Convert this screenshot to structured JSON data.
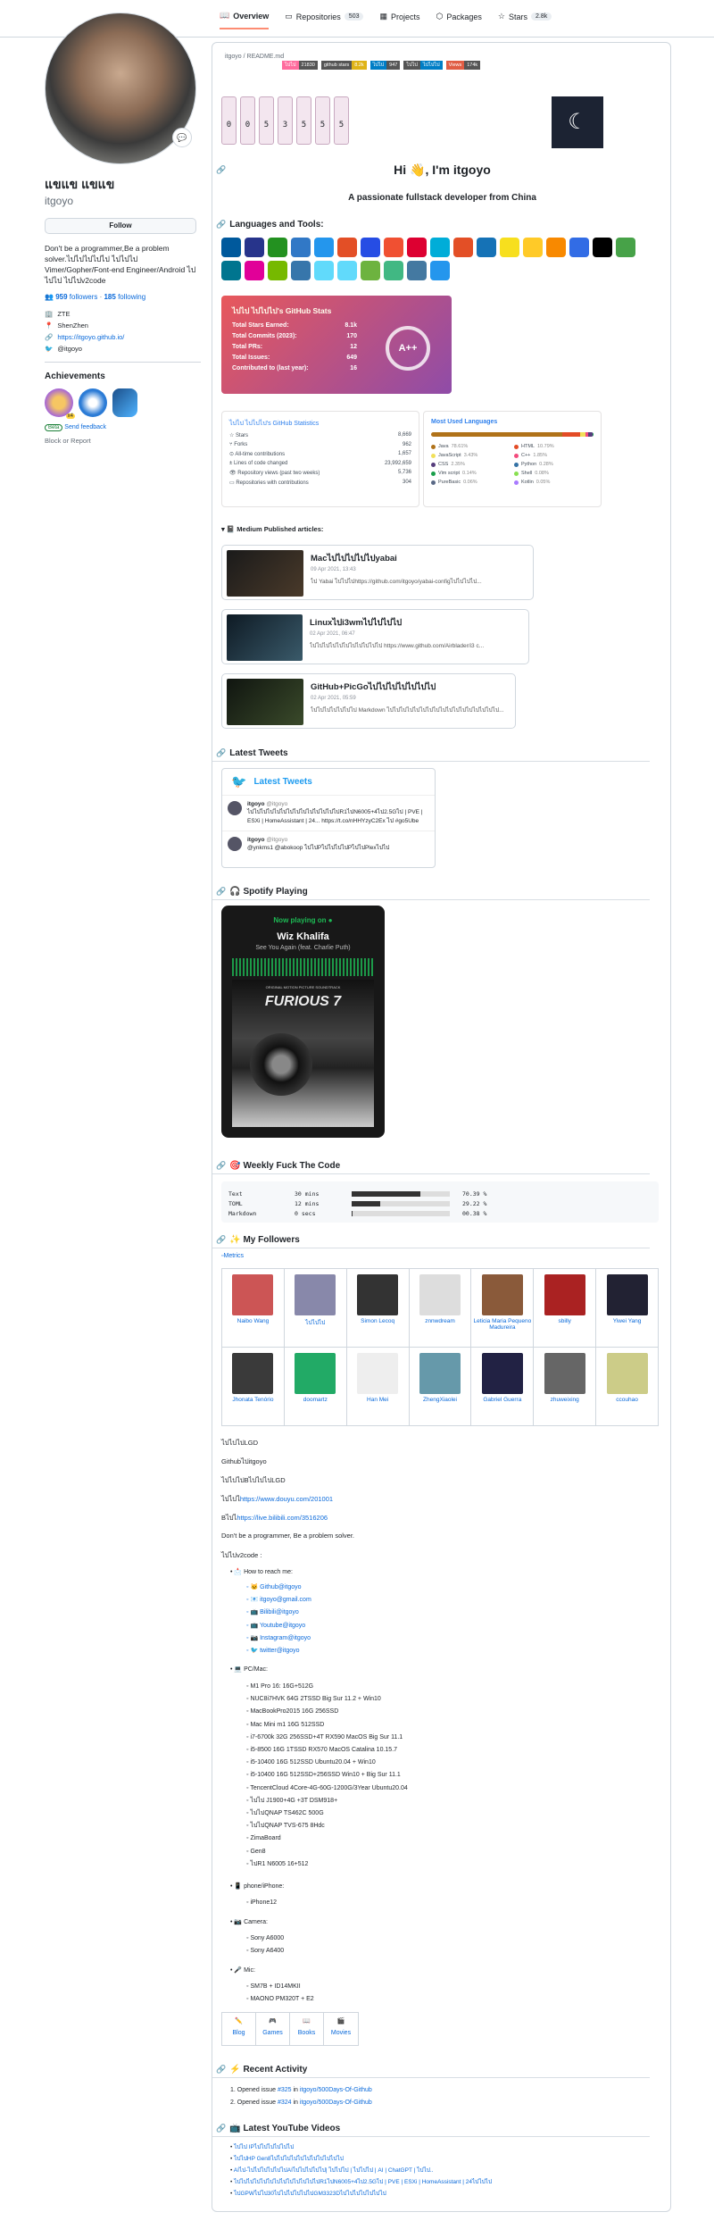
{
  "nav": {
    "tabs": [
      {
        "label": "Overview"
      },
      {
        "label": "Repositories",
        "count": "503"
      },
      {
        "label": "Projects"
      },
      {
        "label": "Packages"
      },
      {
        "label": "Stars",
        "count": "2.8k"
      }
    ]
  },
  "profile": {
    "name": "แขแข แขแข",
    "login": "itgoyo",
    "follow_label": "Follow",
    "bio": "Don't be a programmer,Be a problem solver.ไปไปไปไปไป ไปไปไป Vimer/Gopher/Font-end Engineer/Android ไปไปไป ไปไปv2code",
    "followers_count": "959",
    "followers_label": "followers",
    "following_count": "185",
    "following_label": "following",
    "company": "ZTE",
    "location": "ShenZhen",
    "website": "https://itgoyo.github.io/",
    "twitter": "@itgoyo",
    "achievements_title": "Achievements",
    "beta_label": "Beta",
    "feedback_label": "Send feedback",
    "block_label": "Block or Report",
    "badge_count": "x4"
  },
  "readme": {
    "path": "itgoyo / README.md",
    "badges": [
      {
        "left": "ไปไป",
        "right": "21830",
        "color": "#e05d44"
      },
      {
        "left": "github stars",
        "right": "8.2k",
        "color": "#dfb317"
      },
      {
        "left": "ไปไป",
        "right": "947",
        "color": "#007ec6"
      },
      {
        "left": "ไปไป",
        "right": "ไปไปไป",
        "color": "#007ec6"
      },
      {
        "left": "Views",
        "right": "174k",
        "color": "#e05d44"
      }
    ],
    "counter_digits": [
      "0",
      "0",
      "5",
      "3",
      "5",
      "5",
      "5"
    ],
    "moon_glyph": "☾",
    "greeting": "Hi 👋, I'm itgoyo",
    "tagline": "A passionate fullstack developer from China",
    "languages_heading": "Languages and Tools:",
    "logo_colors": [
      "#00599c",
      "#27348b",
      "#239120",
      "#3178c6",
      "#2496ed",
      "#e34f26",
      "#264de4",
      "#f05032",
      "#dd0031",
      "#00add8",
      "#e34f26",
      "#1572b6",
      "#f7df1e",
      "#ffca28",
      "#f88900",
      "#326ce5",
      "#000000",
      "#47a248",
      "#00758f",
      "#e10098",
      "#76b900",
      "#3776ab",
      "#61dafb",
      "#61dafb",
      "#6db33f",
      "#41b883",
      "#4479a1",
      "#2496ed"
    ],
    "stats_card": {
      "title": "ไปไป ไปไปไป's GitHub Stats",
      "rows": [
        {
          "label": "Total Stars Earned:",
          "value": "8.1k"
        },
        {
          "label": "Total Commits (2023):",
          "value": "170"
        },
        {
          "label": "Total PRs:",
          "value": "12"
        },
        {
          "label": "Total Issues:",
          "value": "649"
        },
        {
          "label": "Contributed to (last year):",
          "value": "16"
        }
      ],
      "grade": "A++"
    },
    "gh_stats": {
      "title": "ไปไป ไปไปไป's GitHub Statistics",
      "rows": [
        {
          "label": "Stars",
          "value": "8,669"
        },
        {
          "label": "Forks",
          "value": "962"
        },
        {
          "label": "All-time contributions",
          "value": "1,657"
        },
        {
          "label": "Lines of code changed",
          "value": "23,992,659"
        },
        {
          "label": "Repository views (past two weeks)",
          "value": "5,736"
        },
        {
          "label": "Repositories with contributions",
          "value": "304"
        }
      ]
    },
    "top_langs": {
      "title": "Most Used Languages",
      "items": [
        {
          "name": "Java",
          "pct": "78.61%",
          "color": "#b07219",
          "value": 78.61
        },
        {
          "name": "HTML",
          "pct": "10.79%",
          "color": "#e34c26",
          "value": 10.79
        },
        {
          "name": "JavaScript",
          "pct": "3.43%",
          "color": "#f1e05a",
          "value": 3.43
        },
        {
          "name": "C++",
          "pct": "1.85%",
          "color": "#f34b7d",
          "value": 1.85
        },
        {
          "name": "CSS",
          "pct": "2.35%",
          "color": "#563d7c",
          "value": 2.35
        },
        {
          "name": "Python",
          "pct": "0.28%",
          "color": "#3572a5",
          "value": 0.28
        },
        {
          "name": "Vim script",
          "pct": "0.14%",
          "color": "#199f4b",
          "value": 0.14
        },
        {
          "name": "Shell",
          "pct": "0.08%",
          "color": "#89e051",
          "value": 0.08
        },
        {
          "name": "PureBasic",
          "pct": "0.06%",
          "color": "#5a6986",
          "value": 0.06
        },
        {
          "name": "Kotlin",
          "pct": "0.05%",
          "color": "#a97bff",
          "value": 0.05
        }
      ]
    },
    "medium_heading": "📓 Medium Published articles:",
    "articles": [
      {
        "title": "Macไปไปไปไปไปyabai",
        "date": "09 Apr 2021, 13:43",
        "desc": "ไป Yabai ไปไปไปhttps://github.com/itgoyo/yabai-configไปไปไปไป..."
      },
      {
        "title": "Linuxไปi3wmไปไปไปไป",
        "date": "02 Apr 2021, 06:47",
        "desc": "ไปไปไปไปไปไปไปไปไปไปไป https://www.github.com/Airblader/i3 c..."
      },
      {
        "title": "GitHub+PicGoไปไปไปไปไปไปไป",
        "date": "02 Apr 2021, 05:59",
        "desc": "ไปไปไปไปไปไปไป Markdown ไปไปไปไปไปไปไปไปไปไปไปไปไปไปไปไปไป..."
      }
    ],
    "tweets_heading": "Latest Tweets",
    "tweets_card_title": "Latest Tweets",
    "tweets": [
      {
        "user": "itgoyo",
        "handle": "@itgoyo",
        "text": "ไปไปไปไปไปไปไปไปไปไปไปไปไปไปR1ไปN6005+4ไป2.5Gไป | PVE | ESXi | HomeAssistant | 24... https://t.co/nHHYzyC2Ex ไป #go5Ube"
      },
      {
        "user": "itgoyo",
        "handle": "@itgoyo",
        "text": "@ynkms1 @abokoop ไปไปPไปไปไปไปPไปไปPlexไปไป"
      }
    ],
    "spotify_heading": "🎧 Spotify Playing",
    "spotify": {
      "now_playing": "Now playing on",
      "artist": "Wiz Khalifa",
      "track": "See You Again (feat. Charlie Puth)",
      "album_title": "FURIOUS 7",
      "album_sub": "ORIGINAL MOTION PICTURE SOUNDTRACK"
    },
    "waka_heading": "🎯 Weekly Fuck The Code",
    "waka": [
      {
        "lang": "Text",
        "time": "30 mins",
        "pct": "70.39 %",
        "value": 70.39
      },
      {
        "lang": "TOML",
        "time": "12 mins",
        "pct": "29.22 %",
        "value": 29.22
      },
      {
        "lang": "Markdown",
        "time": "0 secs",
        "pct": "00.38 %",
        "value": 0.38
      }
    ],
    "followers_heading": "✨ My Followers",
    "metrics_alt": "Metrics",
    "followers": [
      {
        "name": "Naibo Wang",
        "color": "#c55"
      },
      {
        "name": "ไปไปไป",
        "color": "#88a"
      },
      {
        "name": "Simon Lecoq",
        "color": "#333"
      },
      {
        "name": "znnwdream",
        "color": "#ddd"
      },
      {
        "name": "Leticia Maria Pequeno Madureira",
        "color": "#8a5a3a"
      },
      {
        "name": "sbilly",
        "color": "#a22"
      },
      {
        "name": "Yiwei Yang",
        "color": "#223"
      },
      {
        "name": "Jhonata Tenório",
        "color": "#3a3a3a"
      },
      {
        "name": "doomartz",
        "color": "#2a6"
      },
      {
        "name": "Han Mei",
        "color": "#eee"
      },
      {
        "name": "ZhengXiaolei",
        "color": "#69a"
      },
      {
        "name": "Gabriel Guerra",
        "color": "#224"
      },
      {
        "name": "zhuweixing",
        "color": "#666"
      },
      {
        "name": "ccouhao",
        "color": "#cc8"
      }
    ],
    "about_lines": [
      "ไปไปไปLGD",
      "Githubไปitgoyo",
      "ไปไปไปBไปไปไปLGD"
    ],
    "douyu_prefix": "ไปไปไ",
    "douyu_link": "https://www.douyu.com/201001",
    "bilibili_prefix": "Bไปไ",
    "bilibili_link": "https://live.bilibili.com/3516206",
    "motto": "Don't be a programmer, Be a problem solver.",
    "v2code": "ไปไปv2code :",
    "reach_label": "📩 How to reach me:",
    "reach": [
      "🐱 Github@itgoyo",
      "📧 itgoyo@gmail.com",
      "📺 Bilibili@itgoyo",
      "📺 Youtube@itgoyo",
      "📷 Instagram@itgoyo",
      "🐦 twitter@itgoyo"
    ],
    "pc_label": "💻 PC/Mac:",
    "pc": [
      "M1 Pro 16: 16G+512G",
      "NUC8i7HVK 64G 2TSSD Big Sur 11.2 + Win10",
      "MacBookPro2015 16G 256SSD",
      "Mac Mini m1 16G 512SSD",
      "i7-6700k 32G 256SSD+4T RX590 MacOS Big Sur 11.1",
      "i5-8500 16G 1TSSD RX570 MacOS Catalina 10.15.7",
      "i5-10400 16G 512SSD Ubuntu20.04 + Win10",
      "i5-10400 16G 512SSD+256SSD Win10 + Big Sur 11.1",
      "TencentCloud 4Core-4G-60G-1200G/3Year Ubuntu20.04",
      "ไปไป J1900+4G +3T DSM918+",
      "ไปไปQNAP TS462C 500G",
      "ไปไปQNAP TVS-675 8Hdc",
      "ZimaBoard",
      "Gen8",
      "ไปR1 N6005 16+512"
    ],
    "phone_label": "📱 phone/iPhone:",
    "phone": [
      "iPhone12"
    ],
    "camera_label": "📷 Camera:",
    "camera": [
      "Sony A6000",
      "Sony A6400"
    ],
    "mic_label": "🎤 Mic:",
    "mic": [
      "SM7B + ID14MKII",
      "MAONO PM320T + E2"
    ],
    "hobbies": [
      {
        "icon": "✏️",
        "label": "Blog"
      },
      {
        "icon": "🎮",
        "label": "Games"
      },
      {
        "icon": "📖",
        "label": "Books"
      },
      {
        "icon": "🎬",
        "label": "Movies"
      }
    ],
    "activity_heading": "⚡ Recent Activity",
    "activity": [
      {
        "text": "Opened issue",
        "issue": "#325",
        "in": "in",
        "repo": "itgoyo/500Days-Of-Github"
      },
      {
        "text": "Opened issue",
        "issue": "#324",
        "in": "in",
        "repo": "itgoyo/500Days-Of-Github"
      }
    ],
    "youtube_heading": "📺 Latest YouTube Videos",
    "videos": [
      "ไปไป IPไปไปไปไปไปไป",
      "ไปไปHP Gen8ไปไปไปไปไปไปไปไปไปไปไป",
      "AIไป-ไปไปไปไปไปไปAIไปไปไปไปไป| ไปไปไป | ไปไปไป | AI | ChatGPT | ไปไป..",
      "ไปไปไปไปไปไปไปไปไปไปไปไปไปR1ไปN6005+4ไป2.5Gไป | PVE | ESXi | HomeAssistant | 24ไปไปไป",
      "ไปGPWไปไป30ไปไปไปไปไปไปGM3323Dไปไปไปไปไปไปไป"
    ]
  }
}
